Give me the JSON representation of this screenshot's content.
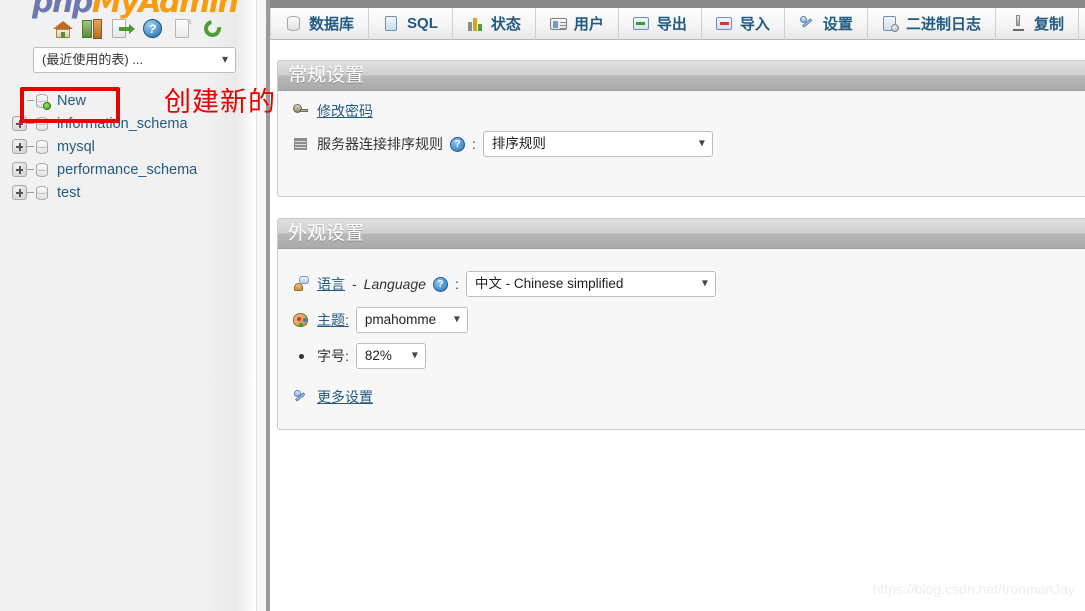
{
  "app": {
    "logo_php": "php",
    "logo_my": "My",
    "logo_admin": "Admin"
  },
  "sidebar": {
    "nav_icons": [
      {
        "name": "home-icon",
        "title": "主页"
      },
      {
        "name": "logout-icon",
        "title": "退出"
      },
      {
        "name": "external-link-icon",
        "title": "打开新窗口"
      },
      {
        "name": "help-icon",
        "title": "帮助"
      },
      {
        "name": "documentation-icon",
        "title": "文档"
      },
      {
        "name": "refresh-icon",
        "title": "重新加载"
      }
    ],
    "recent_tables_label": "(最近使用的表) ...",
    "databases": [
      {
        "label": "New",
        "expandable": false,
        "is_new": true
      },
      {
        "label": "information_schema",
        "expandable": true,
        "is_new": false
      },
      {
        "label": "mysql",
        "expandable": true,
        "is_new": false
      },
      {
        "label": "performance_schema",
        "expandable": true,
        "is_new": false
      },
      {
        "label": "test",
        "expandable": true,
        "is_new": false
      }
    ]
  },
  "annotation": {
    "text": "创建新的数据库",
    "color": "#e60000"
  },
  "tabs": [
    {
      "label": "数据库",
      "icon": "database-icon"
    },
    {
      "label": "SQL",
      "icon": "sql-page-icon"
    },
    {
      "label": "状态",
      "icon": "status-bars-icon"
    },
    {
      "label": "用户",
      "icon": "user-card-icon"
    },
    {
      "label": "导出",
      "icon": "export-icon"
    },
    {
      "label": "导入",
      "icon": "import-icon"
    },
    {
      "label": "设置",
      "icon": "wrench-icon"
    },
    {
      "label": "二进制日志",
      "icon": "binlog-icon"
    },
    {
      "label": "复制",
      "icon": "replication-icon"
    }
  ],
  "general_panel": {
    "title": "常规设置",
    "change_password_label": "修改密码",
    "change_password_icon": "key-icon",
    "collation_label": "服务器连接排序规则",
    "collation_icon": "lines-icon",
    "collation_help": "?",
    "collation_colon": ":",
    "collation_value": "排序规则"
  },
  "appearance_panel": {
    "title": "外观设置",
    "language_label": "语言",
    "language_dash": "-",
    "language_label_en": "Language",
    "language_icon": "language-icon",
    "language_help": "?",
    "language_colon": ":",
    "language_value": "中文 - Chinese simplified",
    "theme_label": "主题:",
    "theme_icon": "palette-icon",
    "theme_value": "pmahomme",
    "fontsize_label": "字号:",
    "fontsize_value": "82%",
    "more_settings_label": "更多设置",
    "more_settings_icon": "wrench-icon"
  },
  "watermark": {
    "text": "https://blog.csdn.net/IronmanJay"
  }
}
